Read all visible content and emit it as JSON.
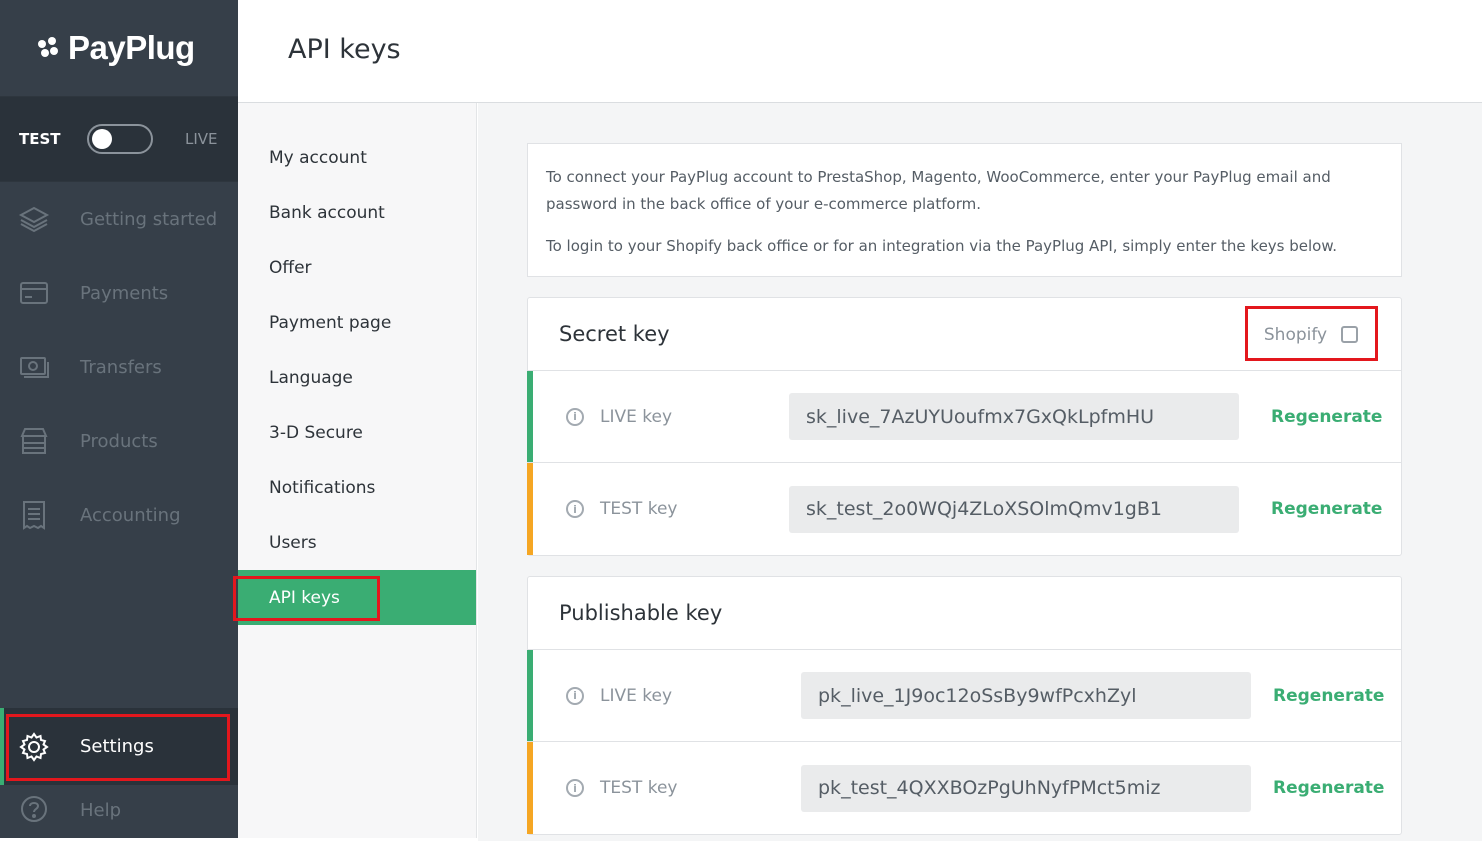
{
  "brand": {
    "name": "PayPlug"
  },
  "environment": {
    "test_label": "TEST",
    "live_label": "LIVE",
    "mode": "test"
  },
  "sidebar": {
    "items": [
      {
        "label": "Getting started",
        "icon": "layers-icon"
      },
      {
        "label": "Payments",
        "icon": "card-icon"
      },
      {
        "label": "Transfers",
        "icon": "banknote-icon"
      },
      {
        "label": "Products",
        "icon": "store-icon"
      },
      {
        "label": "Accounting",
        "icon": "receipt-icon"
      }
    ],
    "settings_label": "Settings",
    "help_label": "Help"
  },
  "header": {
    "title": "API keys"
  },
  "submenu": {
    "items": [
      {
        "label": "My account"
      },
      {
        "label": "Bank account"
      },
      {
        "label": "Offer"
      },
      {
        "label": "Payment page"
      },
      {
        "label": "Language"
      },
      {
        "label": "3-D Secure"
      },
      {
        "label": "Notifications"
      },
      {
        "label": "Users"
      },
      {
        "label": "API keys"
      }
    ],
    "active_index": 8
  },
  "info": {
    "line1": "To connect your PayPlug account to PrestaShop, Magento, WooCommerce, enter your PayPlug email and password in the back office of your e-commerce platform.",
    "line2": "To login to your Shopify back office or for an integration via the PayPlug API, simply enter the keys below."
  },
  "secret_key": {
    "title": "Secret key",
    "shopify_label": "Shopify",
    "shopify_checked": false,
    "live": {
      "label": "LIVE key",
      "value": "sk_live_7AzUYUoufmx7GxQkLpfmHU",
      "action": "Regenerate"
    },
    "test": {
      "label": "TEST key",
      "value": "sk_test_2o0WQj4ZLoXSOlmQmv1gB1",
      "action": "Regenerate"
    }
  },
  "publishable_key": {
    "title": "Publishable key",
    "live": {
      "label": "LIVE key",
      "value": "pk_live_1J9oc12oSsBy9wfPcxhZyl",
      "action": "Regenerate"
    },
    "test": {
      "label": "TEST key",
      "value": "pk_test_4QXXBOzPgUhNyfPMct5miz",
      "action": "Regenerate"
    }
  },
  "colors": {
    "accent": "#3aad73",
    "test": "#f5a623",
    "sidebar": "#363f49",
    "highlight": "#e3171d"
  }
}
